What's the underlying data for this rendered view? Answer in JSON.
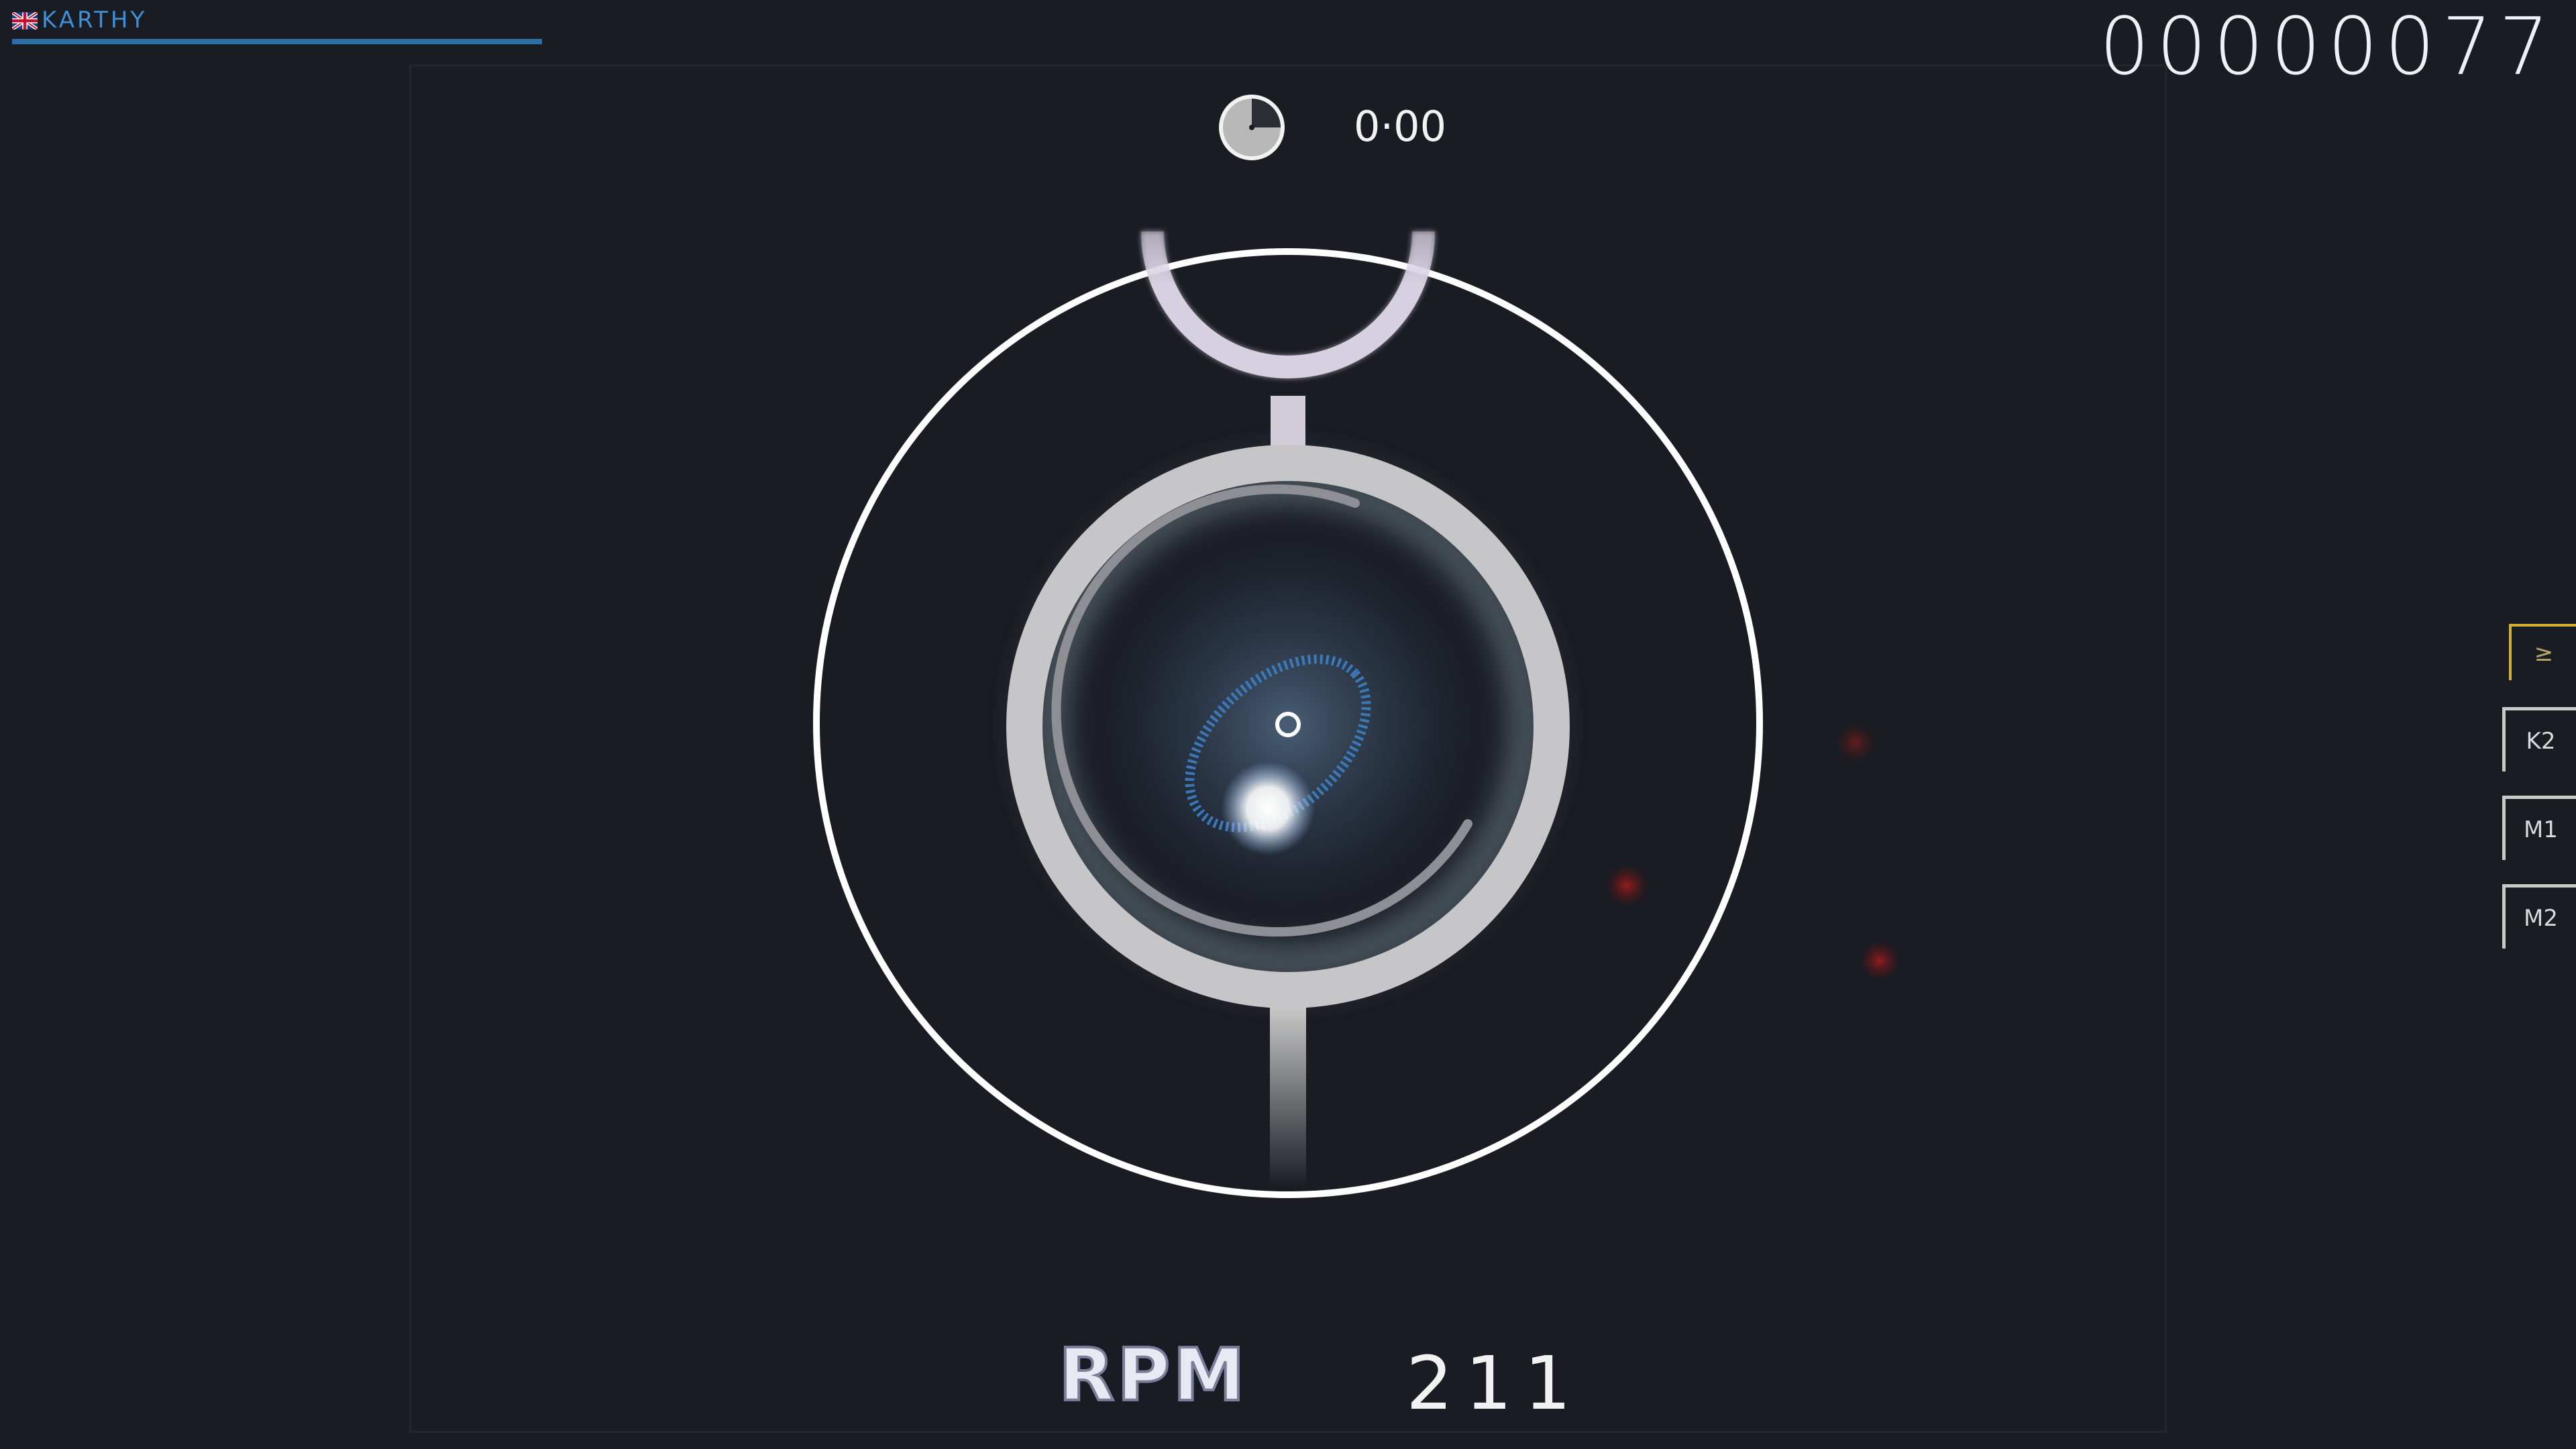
{
  "player": {
    "name": "KARTHY",
    "flag_icon": "uk-flag-icon",
    "health_percent": 100
  },
  "score": "00000077",
  "timer": {
    "text": "0·00",
    "progress_fraction": 0.75
  },
  "rpm": {
    "label": "RPM",
    "value": "211"
  },
  "key_overlay": [
    {
      "label": "≥",
      "active": true
    },
    {
      "label": "K2",
      "active": false
    },
    {
      "label": "M1",
      "active": false
    },
    {
      "label": "M2",
      "active": false
    }
  ],
  "colors": {
    "background": "#1a1c23",
    "accent_blue": "#3f8fd6",
    "spinner_ring": "#ffffff",
    "spinner_body": "#c8c8c8",
    "cursor_trail": "#3d7fc4",
    "miss_dot": "#8a1c1c",
    "key_active": "#d4b03b"
  }
}
